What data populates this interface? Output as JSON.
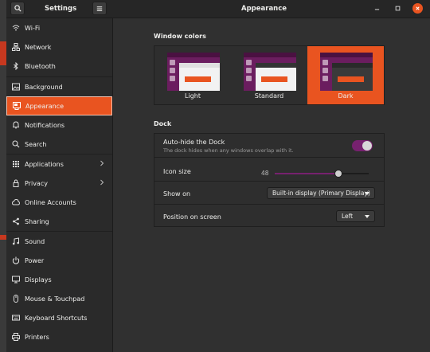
{
  "header": {
    "sidebar_title": "Settings",
    "page_title": "Appearance"
  },
  "sidebar": {
    "items": [
      {
        "label": "Wi-Fi",
        "icon": "wifi-icon"
      },
      {
        "label": "Network",
        "icon": "network-icon"
      },
      {
        "label": "Bluetooth",
        "icon": "bluetooth-icon"
      },
      {
        "label": "Background",
        "icon": "background-icon"
      },
      {
        "label": "Appearance",
        "icon": "appearance-icon",
        "active": true
      },
      {
        "label": "Notifications",
        "icon": "bell-icon"
      },
      {
        "label": "Search",
        "icon": "search-icon"
      },
      {
        "label": "Applications",
        "icon": "applications-icon",
        "chevron": true
      },
      {
        "label": "Privacy",
        "icon": "privacy-icon",
        "chevron": true
      },
      {
        "label": "Online Accounts",
        "icon": "online-accounts-icon"
      },
      {
        "label": "Sharing",
        "icon": "sharing-icon"
      },
      {
        "label": "Sound",
        "icon": "sound-icon"
      },
      {
        "label": "Power",
        "icon": "power-icon"
      },
      {
        "label": "Displays",
        "icon": "displays-icon"
      },
      {
        "label": "Mouse & Touchpad",
        "icon": "mouse-icon"
      },
      {
        "label": "Keyboard Shortcuts",
        "icon": "keyboard-icon"
      },
      {
        "label": "Printers",
        "icon": "printer-icon"
      }
    ]
  },
  "window_colors": {
    "title": "Window colors",
    "variants": [
      {
        "label": "Light",
        "selected": false
      },
      {
        "label": "Standard",
        "selected": false
      },
      {
        "label": "Dark",
        "selected": true
      }
    ]
  },
  "dock": {
    "title": "Dock",
    "auto_hide": {
      "label": "Auto-hide the Dock",
      "description": "The dock hides when any windows overlap with it.",
      "enabled": true
    },
    "icon_size": {
      "label": "Icon size",
      "value": "48",
      "fraction": 0.68
    },
    "show_on": {
      "label": "Show on",
      "value": "Built-in display (Primary Display)"
    },
    "position": {
      "label": "Position on screen",
      "value": "Left"
    }
  },
  "colors": {
    "accent": "#e95420",
    "aubergine": "#77216f"
  }
}
